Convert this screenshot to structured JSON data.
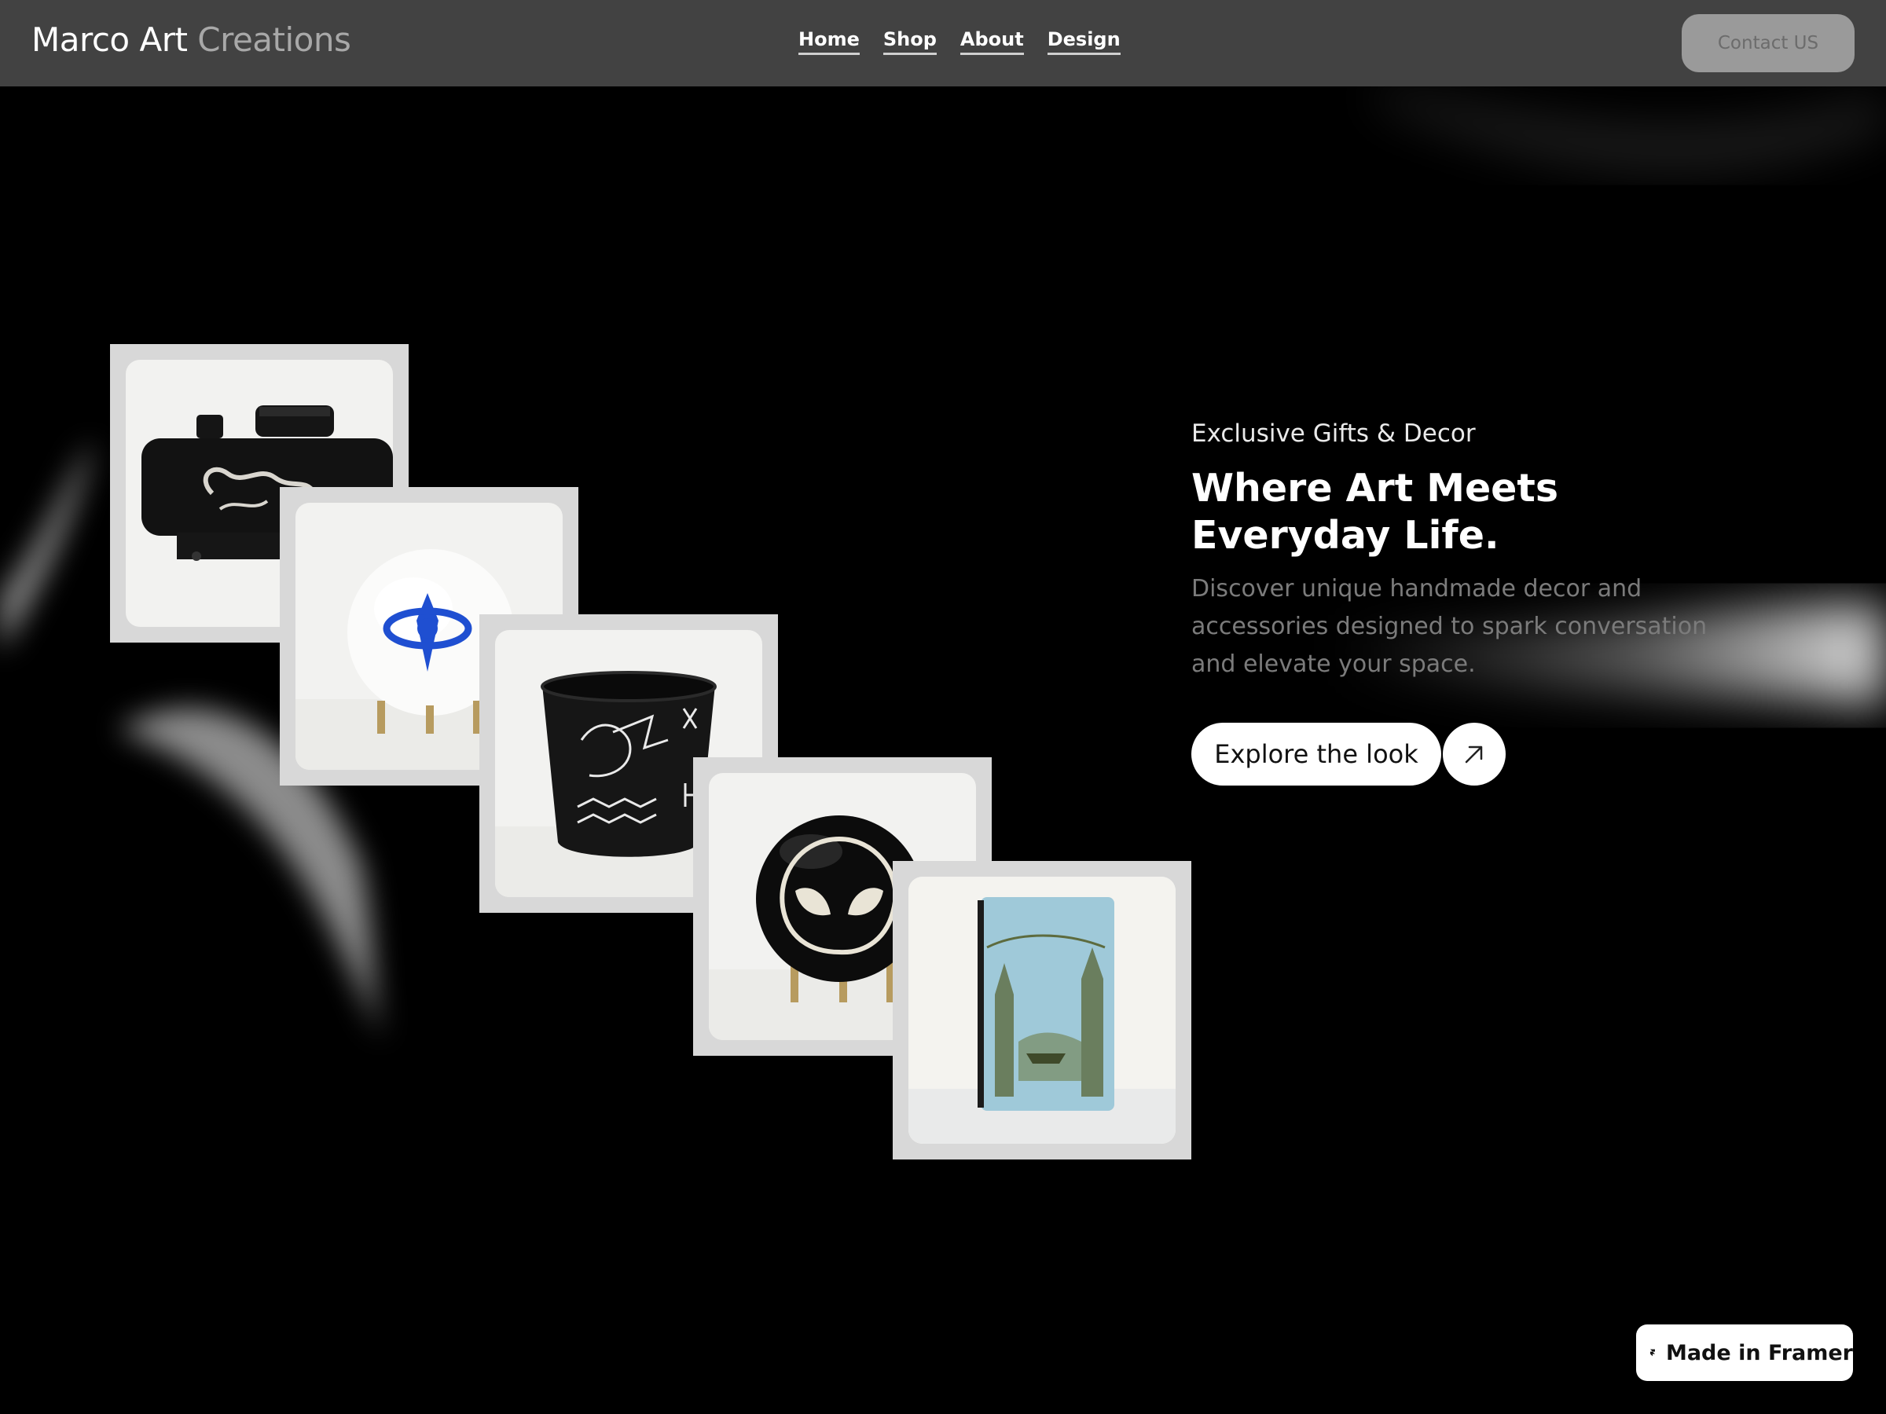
{
  "header": {
    "brand_primary": "Marco Art",
    "brand_secondary": "Creations",
    "nav": [
      "Home",
      "Shop",
      "About",
      "Design"
    ],
    "contact_label": "Contact US"
  },
  "hero": {
    "eyebrow": "Exclusive Gifts & Decor",
    "headline": "Where Art Meets Everyday Life.",
    "description": "Discover unique handmade decor and accessories designed to spark conversation and elevate your space.",
    "cta_label": "Explore the look",
    "cta_icon": "arrow-up-right-icon"
  },
  "products": [
    {
      "name": "dragon-engraved-red-dot-sight"
    },
    {
      "name": "white-sphere-blue-eye-symbol"
    },
    {
      "name": "black-cup-dragon-runes"
    },
    {
      "name": "black-sphere-alien-face"
    },
    {
      "name": "blue-pouch-forest-river-print"
    }
  ],
  "badge": {
    "label": "Made in Framer",
    "icon": "framer-logo-icon"
  },
  "colors": {
    "header_bg": "#424242",
    "page_bg": "#000000",
    "contact_bg": "#9a9a9a"
  }
}
